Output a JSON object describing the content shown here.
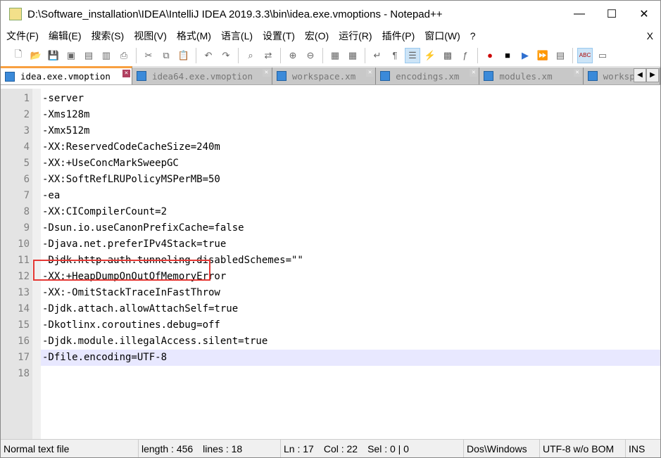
{
  "window": {
    "title": "D:\\Software_installation\\IDEA\\IntelliJ IDEA 2019.3.3\\bin\\idea.exe.vmoptions - Notepad++"
  },
  "menu": [
    "文件(F)",
    "编辑(E)",
    "搜索(S)",
    "视图(V)",
    "格式(M)",
    "语言(L)",
    "设置(T)",
    "宏(O)",
    "运行(R)",
    "插件(P)",
    "窗口(W)",
    "?"
  ],
  "menu_close": "X",
  "tabs": [
    {
      "label": "idea.exe.vmoption",
      "active": true
    },
    {
      "label": "idea64.exe.vmoption"
    },
    {
      "label": "workspace.xm"
    },
    {
      "label": "encodings.xm"
    },
    {
      "label": "modules.xm"
    },
    {
      "label": "worksp"
    }
  ],
  "editor": {
    "lines": [
      "-server",
      "-Xms128m",
      "-Xmx512m",
      "-XX:ReservedCodeCacheSize=240m",
      "-XX:+UseConcMarkSweepGC",
      "-XX:SoftRefLRUPolicyMSPerMB=50",
      "-ea",
      "-XX:CICompilerCount=2",
      "-Dsun.io.useCanonPrefixCache=false",
      "-Djava.net.preferIPv4Stack=true",
      "-Djdk.http.auth.tunneling.disabledSchemes=\"\"",
      "-XX:+HeapDumpOnOutOfMemoryError",
      "-XX:-OmitStackTraceInFastThrow",
      "-Djdk.attach.allowAttachSelf=true",
      "-Dkotlinx.coroutines.debug=off",
      "-Djdk.module.illegalAccess.silent=true",
      "-Dfile.encoding=UTF-8",
      ""
    ],
    "current_line": 17,
    "highlight_color": "#e53935"
  },
  "status": {
    "type": "Normal text file",
    "length": "length : 456",
    "lines": "lines : 18",
    "ln": "Ln : 17",
    "col": "Col : 22",
    "sel": "Sel : 0 | 0",
    "eol": "Dos\\Windows",
    "encoding": "UTF-8 w/o BOM",
    "mode": "INS"
  }
}
